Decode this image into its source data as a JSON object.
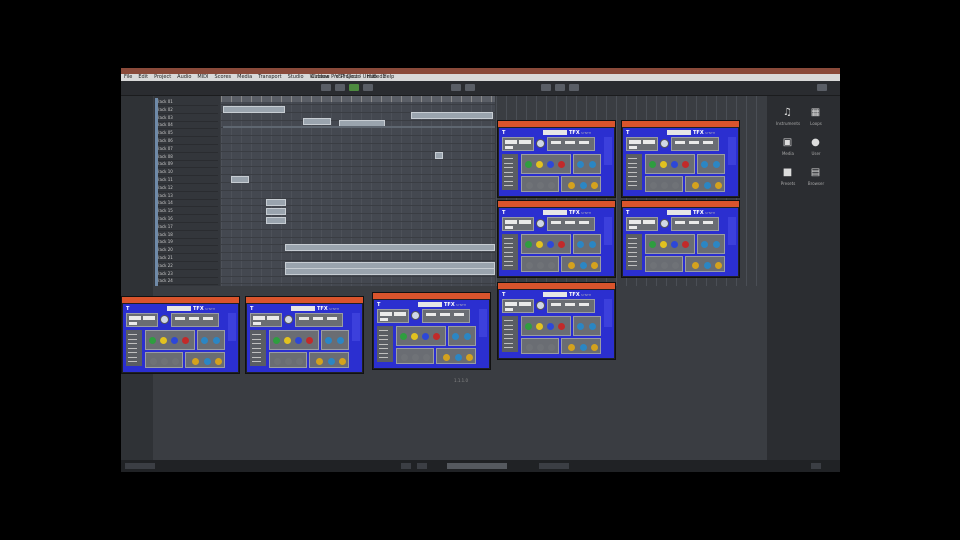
{
  "app": {
    "menu_items": [
      "File",
      "Edit",
      "Project",
      "Audio",
      "MIDI",
      "Scores",
      "Media",
      "Transport",
      "Studio",
      "Window",
      "VST Cloud",
      "Hub",
      "Help"
    ],
    "window_title": "Cubase Pro Project - Untitled1",
    "toolbar_label": "",
    "track_names": [
      "Track 01",
      "Track 02",
      "Track 03",
      "Track 04",
      "Track 05",
      "Track 06",
      "Track 07",
      "Track 08",
      "Track 09",
      "Track 10",
      "Track 11",
      "Track 12",
      "Track 13",
      "Track 14",
      "Track 15",
      "Track 16",
      "Track 17",
      "Track 18",
      "Track 19",
      "Track 20",
      "Track 21",
      "Track 22",
      "Track 23",
      "Track 24"
    ],
    "position_label": "1.1.1.0"
  },
  "right_panel": {
    "icons": [
      {
        "name": "piano-icon",
        "glyph": "♫",
        "label": "Instruments"
      },
      {
        "name": "keyboard-icon",
        "glyph": "▦",
        "label": "Loops"
      },
      {
        "name": "grid-icon",
        "glyph": "▣",
        "label": "Media"
      },
      {
        "name": "user-icon",
        "glyph": "●",
        "label": "User"
      },
      {
        "name": "stop-icon",
        "glyph": "■",
        "label": "Presets"
      },
      {
        "name": "drawer-icon",
        "glyph": "▤",
        "label": "Browser"
      }
    ]
  },
  "plugin": {
    "title": "Instrument",
    "logo_text": "T",
    "brand": "TFX",
    "brand_sub": "SYNTH",
    "colors": {
      "accent": "#d9542c",
      "body": "#2b2fd0",
      "panel": "#6a6d73"
    },
    "knob_colors": [
      "#2e9e3f",
      "#e2c21f",
      "#2d47d8",
      "#c22a2a",
      "#2b86c4",
      "#d4a21e",
      "#6f7277"
    ]
  }
}
